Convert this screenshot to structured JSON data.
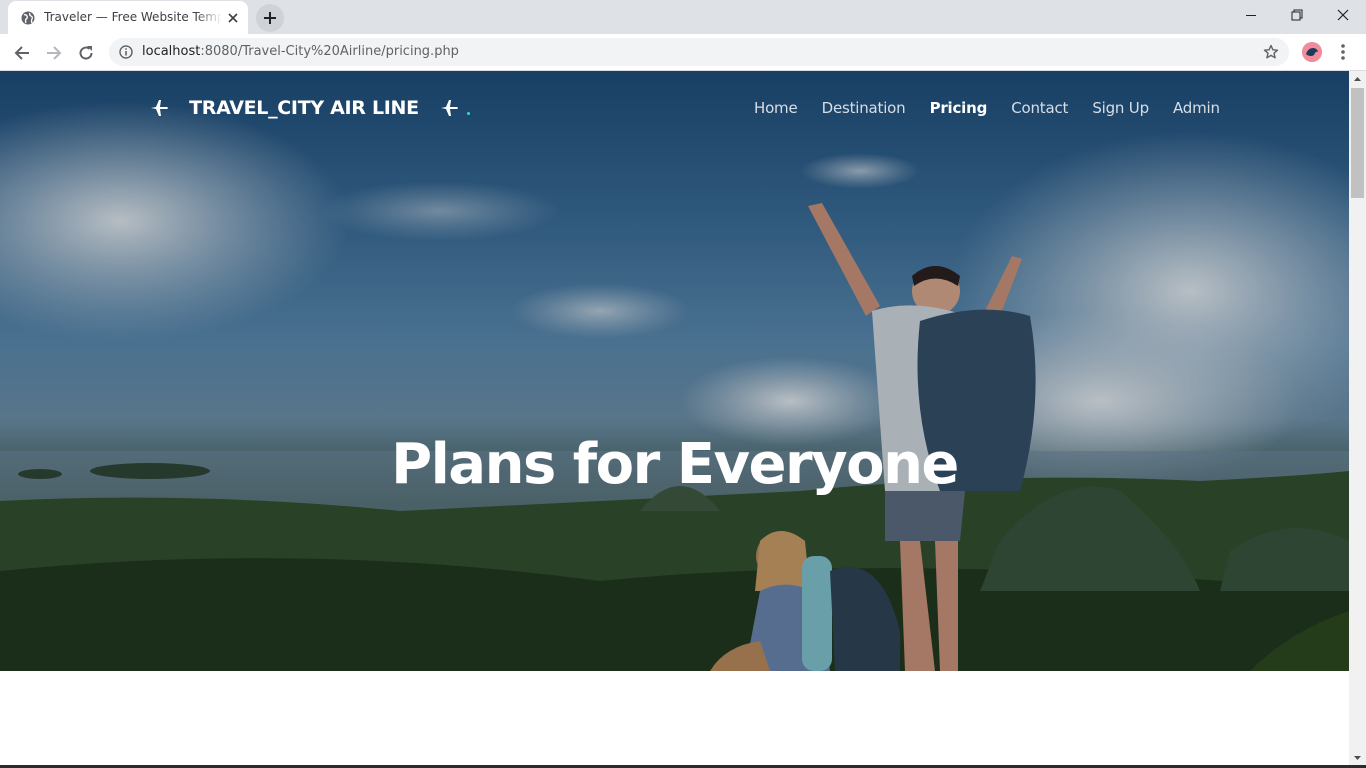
{
  "browser": {
    "tab_title": "Traveler — Free Website Template",
    "url_host": "localhost",
    "url_rest": ":8080/Travel-City%20Airline/pricing.php"
  },
  "site": {
    "brand": "TRAVEL_CITY AIR LINE",
    "nav": [
      {
        "label": "Home",
        "active": false
      },
      {
        "label": "Destination",
        "active": false
      },
      {
        "label": "Pricing",
        "active": true
      },
      {
        "label": "Contact",
        "active": false
      },
      {
        "label": "Sign Up",
        "active": false
      },
      {
        "label": "Admin",
        "active": false
      }
    ],
    "hero_title": "Plans for Everyone"
  },
  "colors": {
    "accent_dot": "#3fd0d4",
    "tabstrip": "#dee1e6"
  },
  "icons": [
    "globe-icon",
    "close-icon",
    "plus-icon",
    "minimize-icon",
    "maximize-icon",
    "back-icon",
    "forward-icon",
    "reload-icon",
    "info-icon",
    "star-icon",
    "menu-icon",
    "plane-icon"
  ]
}
